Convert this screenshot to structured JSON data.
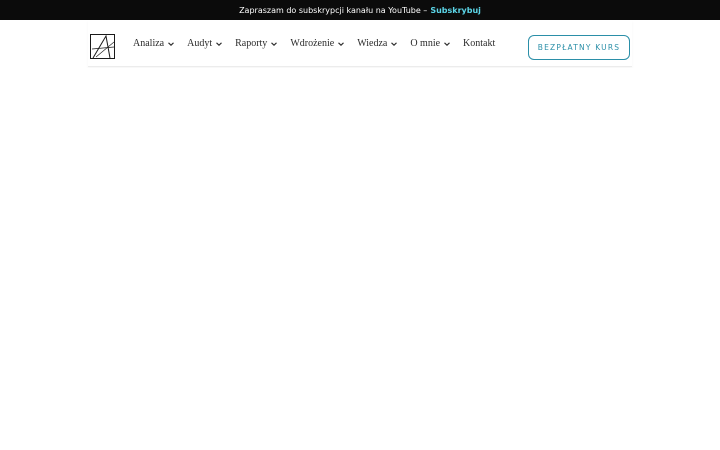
{
  "announcement": {
    "message": "Zapraszam do subskrypcji kanału na YouTube –",
    "link_label": "Subskrybuj",
    "link_color": "#5cd6e8"
  },
  "header": {
    "logo_icon": "logo-icon",
    "nav": [
      {
        "label": "Analiza",
        "has_dropdown": true
      },
      {
        "label": "Audyt",
        "has_dropdown": true
      },
      {
        "label": "Raporty",
        "has_dropdown": true
      },
      {
        "label": "Wdrożenie",
        "has_dropdown": true
      },
      {
        "label": "Wiedza",
        "has_dropdown": true
      },
      {
        "label": "O mnie",
        "has_dropdown": true
      },
      {
        "label": "Kontakt",
        "has_dropdown": false
      }
    ],
    "cta_label": "BEZPŁATNY KURS",
    "accent_color": "#2b8fa8"
  }
}
